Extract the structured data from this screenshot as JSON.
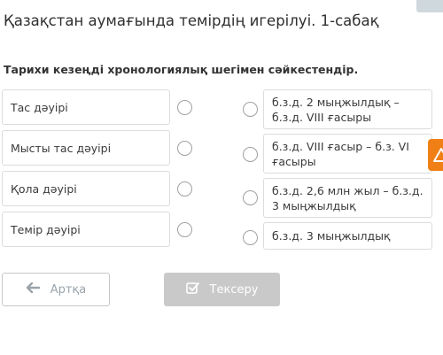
{
  "lesson": {
    "title": "Қазақстан аумағында темірдің игерілуі. 1-сабақ"
  },
  "task": {
    "instruction": "Тарихи кезеңді хронологиялық шегімен сәйкестендір."
  },
  "periods": [
    {
      "label": "Тас дәуірі"
    },
    {
      "label": "Мысты тас дәуірі"
    },
    {
      "label": "Қола дәуірі"
    },
    {
      "label": "Темір дәуірі"
    }
  ],
  "dates": [
    {
      "label": "б.з.д. 2 мыңжылдық – б.з.д. VIII ғасыры"
    },
    {
      "label": "б.з.д. VIII ғасыр – б.з. VI ғасыры"
    },
    {
      "label": "б.з.д. 2,6 млн жыл – б.з.д. 3 мыңжылдық"
    },
    {
      "label": "б.з.д. 3 мыңжылдық"
    }
  ],
  "nav": {
    "back_label": "Артқа",
    "back_icon": "arrow-left-icon",
    "check_label": "Тексеру",
    "check_icon": "check-square-icon"
  },
  "colors": {
    "warning_tab": "#f07f16",
    "check_button_disabled": "#c9c9c9"
  }
}
